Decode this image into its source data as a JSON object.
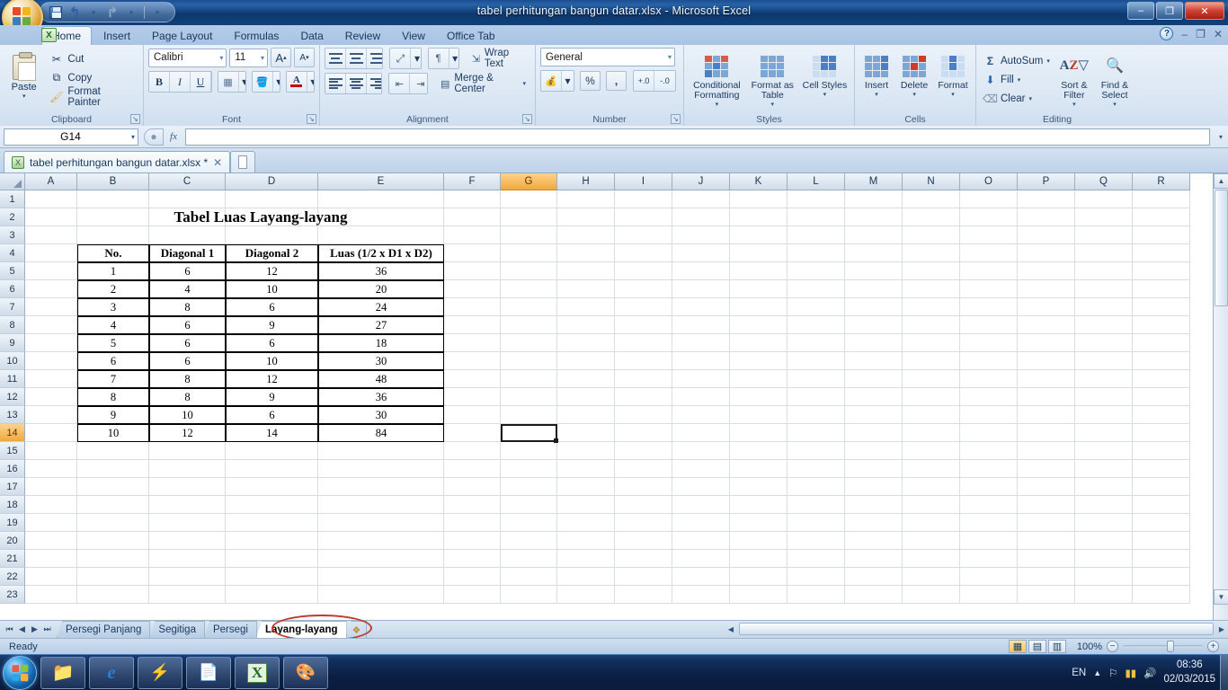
{
  "window": {
    "title": "tabel perhitungan bangun datar.xlsx - Microsoft Excel",
    "minimize": "–",
    "restore": "❐",
    "close": "✕"
  },
  "quick_access": {
    "save": "save-icon",
    "undo": "↰",
    "redo": "↱",
    "undo_caret": "▾",
    "redo_caret": "▾",
    "customize_caret": "▾"
  },
  "ribbon": {
    "tabs": [
      {
        "label": "Home",
        "active": true
      },
      {
        "label": "Insert",
        "active": false
      },
      {
        "label": "Page Layout",
        "active": false
      },
      {
        "label": "Formulas",
        "active": false
      },
      {
        "label": "Data",
        "active": false
      },
      {
        "label": "Review",
        "active": false
      },
      {
        "label": "View",
        "active": false
      },
      {
        "label": "Office Tab",
        "active": false
      }
    ],
    "help": "?",
    "doc_minimize": "–",
    "doc_restore": "❐",
    "doc_close": "✕",
    "groups": {
      "clipboard": {
        "label": "Clipboard",
        "paste": "Paste",
        "cut": "Cut",
        "copy": "Copy",
        "format_painter": "Format Painter"
      },
      "font": {
        "label": "Font",
        "font_name": "Calibri",
        "font_size": "11",
        "grow_font": "A",
        "shrink_font": "A",
        "bold": "B",
        "italic": "I",
        "underline": "U",
        "borders": "▦",
        "fill_color": "A",
        "font_color": "A"
      },
      "alignment": {
        "label": "Alignment",
        "wrap_text": "Wrap Text",
        "merge_center": "Merge & Center",
        "orientation": "↗",
        "indent_marker": "¶"
      },
      "number": {
        "label": "Number",
        "format": "General",
        "percent": "%",
        "comma": ",",
        "increase_decimal": "+.0",
        "decrease_decimal": "-.0"
      },
      "styles": {
        "label": "Styles",
        "conditional_formatting": "Conditional Formatting",
        "format_as_table": "Format as Table",
        "cell_styles": "Cell Styles"
      },
      "cells": {
        "label": "Cells",
        "insert": "Insert",
        "delete": "Delete",
        "format": "Format"
      },
      "editing": {
        "label": "Editing",
        "autosum": "AutoSum",
        "fill": "Fill",
        "clear": "Clear",
        "sort_filter": "Sort & Filter",
        "find_select": "Find & Select"
      }
    }
  },
  "formula_bar": {
    "name_box": "G14",
    "formula_value": "",
    "fx": "fx",
    "dropdown_caret": "▾"
  },
  "document_tabs": [
    {
      "label": "tabel perhitungan bangun datar.xlsx *",
      "close": "✕",
      "active": true
    }
  ],
  "grid": {
    "columns": [
      "A",
      "B",
      "C",
      "D",
      "E",
      "F",
      "G",
      "H",
      "I",
      "J",
      "K",
      "L",
      "M",
      "N",
      "O",
      "P",
      "Q",
      "R"
    ],
    "active_column": "G",
    "rows": [
      "1",
      "2",
      "3",
      "4",
      "5",
      "6",
      "7",
      "8",
      "9",
      "10",
      "11",
      "12",
      "13",
      "14",
      "15",
      "16",
      "17",
      "18",
      "19",
      "20",
      "21",
      "22",
      "23"
    ],
    "active_row": "14",
    "selected_cell": "G14"
  },
  "sheet": {
    "title": "Tabel Luas Layang-layang",
    "headers": [
      "No.",
      "Diagonal 1",
      "Diagonal 2",
      "Luas (1/2 x D1 x D2)"
    ],
    "rows": [
      [
        "1",
        "6",
        "12",
        "36"
      ],
      [
        "2",
        "4",
        "10",
        "20"
      ],
      [
        "3",
        "8",
        "6",
        "24"
      ],
      [
        "4",
        "6",
        "9",
        "27"
      ],
      [
        "5",
        "6",
        "6",
        "18"
      ],
      [
        "6",
        "6",
        "10",
        "30"
      ],
      [
        "7",
        "8",
        "12",
        "48"
      ],
      [
        "8",
        "8",
        "9",
        "36"
      ],
      [
        "9",
        "10",
        "6",
        "30"
      ],
      [
        "10",
        "12",
        "14",
        "84"
      ]
    ]
  },
  "sheet_tabs": {
    "nav_first": "⏮",
    "nav_prev": "◀",
    "nav_next": "▶",
    "nav_last": "⏭",
    "items": [
      {
        "label": "Persegi Panjang",
        "active": false
      },
      {
        "label": "Segitiga",
        "active": false
      },
      {
        "label": "Persegi",
        "active": false
      },
      {
        "label": "Layang-layang",
        "active": true
      }
    ],
    "new_sheet": "⊞"
  },
  "status_bar": {
    "status": "Ready",
    "zoom": "100%",
    "zoom_out": "−",
    "zoom_in": "+",
    "view_normal": "▦",
    "view_layout": "▤",
    "view_pagebreak": "▥"
  },
  "taskbar": {
    "start": "start-orb",
    "items": [
      {
        "name": "explorer-icon"
      },
      {
        "name": "internet-explorer-icon"
      },
      {
        "name": "winamp-icon"
      },
      {
        "name": "word-icon"
      },
      {
        "name": "excel-icon"
      },
      {
        "name": "paint-icon"
      }
    ],
    "tray": {
      "language": "EN",
      "show_hidden": "▲",
      "action_center": "⚑",
      "network": "📶",
      "volume": "🔇",
      "time": "08:36",
      "date": "02/03/2015"
    }
  },
  "colors": {
    "accent_orange": "#f0a93d",
    "title_blue": "#0e3970",
    "annotation_red": "#c0392b"
  }
}
